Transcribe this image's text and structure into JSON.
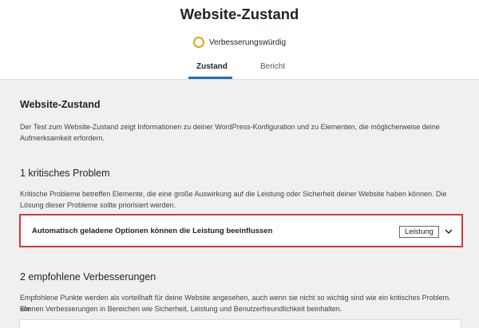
{
  "header": {
    "title": "Website-Zustand",
    "status_label": "Verbesserungswürdig",
    "tabs": [
      {
        "label": "Zustand",
        "active": true
      },
      {
        "label": "Bericht",
        "active": false
      }
    ]
  },
  "main": {
    "section_title": "Website-Zustand",
    "intro_line1": "Der Test zum Website-Zustand zeigt Informationen zu deiner WordPress-Konfiguration und zu Elementen, die möglicherweise deine",
    "intro_line2": "Aufmerksamkeit erfordern.",
    "critical": {
      "heading": "1 kritisches Problem",
      "desc_line1": "Kritische Probleme betreffen Elemente, die eine große Auswirkung auf die Leistung oder Sicherheit deiner Website haben können. Die",
      "desc_line2": "Lösung dieser Probleme sollte priorisiert werden.",
      "issues": [
        {
          "title": "Automatisch geladene Optionen können die Leistung beeinflussen",
          "badge": "Leistung"
        }
      ]
    },
    "recommended": {
      "heading": "2 empfohlene Verbesserungen",
      "desc_line1": "Empfohlene Punkte werden als vorteilhaft für deine Website angesehen, auch wenn sie nicht so wichtig sind wie ein kritisches Problem. Sie",
      "desc_line2": "können Verbesserungen in Bereichen wie Sicherheit, Leistung und Benutzerfreundlichkeit beinhalten."
    }
  },
  "colors": {
    "status_ring": "#dba617",
    "tab_accent": "#2271b1",
    "highlight_border": "#d63638"
  },
  "icons": {
    "status": "status-circle-icon",
    "expand": "chevron-down-icon"
  }
}
